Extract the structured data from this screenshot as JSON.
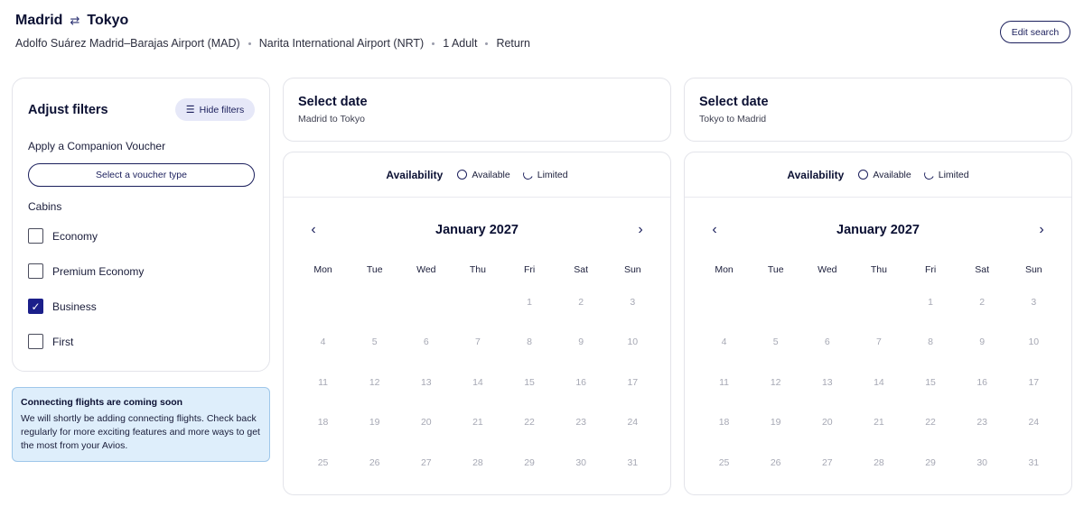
{
  "header": {
    "origin": "Madrid",
    "destination": "Tokyo",
    "swap_icon": "swap-arrows-icon",
    "origin_airport": "Adolfo Suárez Madrid–Barajas Airport (MAD)",
    "destination_airport": "Narita International Airport (NRT)",
    "passengers": "1 Adult",
    "trip_type": "Return",
    "edit_label": "Edit search"
  },
  "filters": {
    "title": "Adjust filters",
    "hide_label": "Hide filters",
    "voucher_label": "Apply a Companion Voucher",
    "voucher_select": "Select a voucher type",
    "cabins_label": "Cabins",
    "cabins": [
      {
        "label": "Economy",
        "checked": false
      },
      {
        "label": "Premium Economy",
        "checked": false
      },
      {
        "label": "Business",
        "checked": true
      },
      {
        "label": "First",
        "checked": false
      }
    ]
  },
  "notice": {
    "title": "Connecting flights are coming soon",
    "body": "We will shortly be adding connecting flights. Check back regularly for more exciting features and more ways to get the most from your Avios."
  },
  "outbound": {
    "title": "Select date",
    "subtitle": "Madrid to Tokyo"
  },
  "inbound": {
    "title": "Select date",
    "subtitle": "Tokyo to Madrid"
  },
  "calendar": {
    "availability_label": "Availability",
    "available_label": "Available",
    "limited_label": "Limited",
    "month": "January 2027",
    "weekdays": [
      "Mon",
      "Tue",
      "Wed",
      "Thu",
      "Fri",
      "Sat",
      "Sun"
    ],
    "weeks": [
      [
        "",
        "",
        "",
        "",
        "1",
        "2",
        "3"
      ],
      [
        "4",
        "5",
        "6",
        "7",
        "8",
        "9",
        "10"
      ],
      [
        "11",
        "12",
        "13",
        "14",
        "15",
        "16",
        "17"
      ],
      [
        "18",
        "19",
        "20",
        "21",
        "22",
        "23",
        "24"
      ],
      [
        "25",
        "26",
        "27",
        "28",
        "29",
        "30",
        "31"
      ]
    ]
  },
  "colors": {
    "brand_navy": "#1b1f5c",
    "checkbox_checked": "#1b1f8a",
    "notice_bg": "#deeefb",
    "disabled_day": "#a6a8b4"
  }
}
